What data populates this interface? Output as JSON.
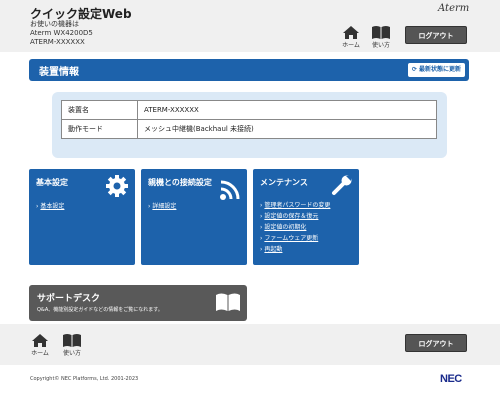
{
  "header": {
    "app_title": "クイック設定Web",
    "device_label": "お使いの機器は",
    "device_model": "Aterm WX4200D5",
    "device_name": "ATERM-XXXXXX",
    "brand": "Aterm",
    "home_label": "ホーム",
    "help_label": "使い方",
    "logout_label": "ログアウト"
  },
  "section": {
    "title": "装置情報",
    "refresh_label": "最新状態に更新"
  },
  "device_table": [
    {
      "key": "装置名",
      "value": "ATERM-XXXXXX"
    },
    {
      "key": "動作モード",
      "value": "メッシュ中継機(Backhaul 未接続)"
    }
  ],
  "cards": {
    "basic": {
      "title": "基本設定",
      "links": [
        "基本設定"
      ]
    },
    "connection": {
      "title": "親機との接続設定",
      "links": [
        "詳細設定"
      ]
    },
    "maintenance": {
      "title": "メンテナンス",
      "links": [
        "管理者パスワードの変更",
        "設定値の保存＆復元",
        "設定値の初期化",
        "ファームウェア更新",
        "再起動"
      ]
    }
  },
  "support": {
    "title": "サポートデスク",
    "description": "Q&A、機能別設定ガイドなどの情報をご覧になれます。"
  },
  "footer": {
    "home_label": "ホーム",
    "help_label": "使い方",
    "logout_label": "ログアウト",
    "copyright": "Copyright© NEC Platforms, Ltd. 2001-2023",
    "nec": "NEC"
  },
  "colors": {
    "primary": "#1d62ab",
    "panel": "#dbe9f6",
    "dark": "#555555"
  }
}
